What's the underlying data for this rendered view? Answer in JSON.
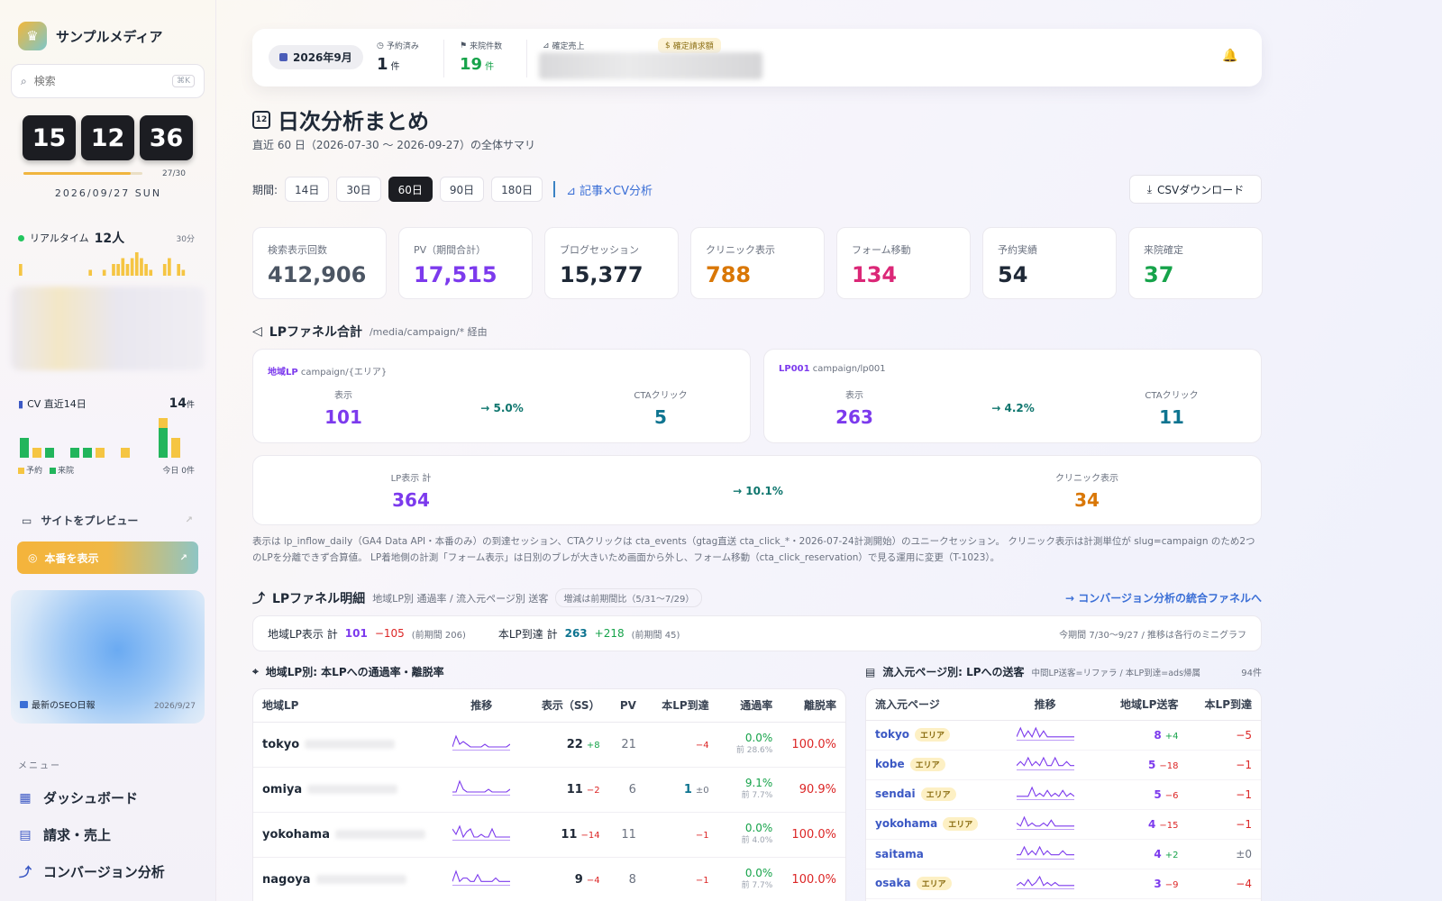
{
  "sidebar": {
    "brand": "サンプルメディア",
    "search_placeholder": "検索",
    "search_kbd": "⌘K",
    "clock": {
      "h": "15",
      "m": "12",
      "s": "36"
    },
    "day_progress_label": "27/30",
    "day_progress_fraction": 0.9,
    "date": "2026/09/27 SUN",
    "realtime_label": "リアルタイム",
    "realtime_count": "12人",
    "realtime_window": "30分",
    "realtime_bars": [
      2,
      0,
      0,
      0,
      0,
      0,
      0,
      0,
      0,
      0,
      0,
      0,
      0,
      0,
      0,
      1,
      0,
      0,
      1,
      0,
      2,
      2,
      3,
      2,
      3,
      4,
      3,
      2,
      1,
      0,
      0,
      2,
      3,
      0,
      2,
      1,
      0,
      0
    ],
    "cv_label": "CV 直近14日",
    "cv_count": "14",
    "cv_unit": "件",
    "cv_bars": [
      {
        "reserve": 0,
        "visit": 4
      },
      {
        "reserve": 2,
        "visit": 0
      },
      {
        "reserve": 0,
        "visit": 2
      },
      {
        "reserve": 0,
        "visit": 0
      },
      {
        "reserve": 0,
        "visit": 2
      },
      {
        "reserve": 0,
        "visit": 2
      },
      {
        "reserve": 2,
        "visit": 0
      },
      {
        "reserve": 0,
        "visit": 0
      },
      {
        "reserve": 2,
        "visit": 0
      },
      {
        "reserve": 0,
        "visit": 0
      },
      {
        "reserve": 0,
        "visit": 0
      },
      {
        "reserve": 2,
        "visit": 6
      },
      {
        "reserve": 4,
        "visit": 0
      },
      {
        "reserve": 0,
        "visit": 0
      }
    ],
    "legend_reserve": "予約",
    "legend_visit": "来院",
    "legend_today": "今日 0件",
    "preview_label": "サイトをプレビュー",
    "honban_label": "本番を表示",
    "seo_label": "最新のSEO日報",
    "seo_date": "2026/9/27",
    "menu_heading": "メニュー",
    "menu": [
      "ダッシュボード",
      "請求・売上",
      "コンバージョン分析"
    ],
    "colors": {
      "reserve": "#f5c542",
      "visit": "#22b55c",
      "accent": "#f0b53e"
    }
  },
  "topbar": {
    "month": "2026年9月",
    "stats": [
      {
        "label": "予約済み",
        "value": "1",
        "unit": "件",
        "icon": "clock-icon"
      },
      {
        "label": "来院件数",
        "value": "19",
        "unit": "件",
        "icon": "flag-icon"
      },
      {
        "label": "確定売上",
        "value": "",
        "unit": "",
        "icon": "chart-icon"
      },
      {
        "label": "確定請求額",
        "value": "",
        "unit": "",
        "icon": "moneybag-icon"
      }
    ]
  },
  "header": {
    "title": "日次分析まとめ",
    "subtitle": "直近 60 日（2026-07-30 〜 2026-09-27）の全体サマリ",
    "period_label": "期間:",
    "periods": [
      "14日",
      "30日",
      "60日",
      "90日",
      "180日"
    ],
    "active_period": "60日",
    "cv_link": "記事×CV分析",
    "csv_button": "CSVダウンロード"
  },
  "kpis": [
    {
      "label": "検索表示回数",
      "value": "412,906",
      "color": "#4b5563"
    },
    {
      "label": "PV（期間合計）",
      "value": "17,515",
      "color": "#7c3aed"
    },
    {
      "label": "ブログセッション",
      "value": "15,377",
      "color": "#1f2937"
    },
    {
      "label": "クリニック表示",
      "value": "788",
      "color": "#d97706"
    },
    {
      "label": "フォーム移動",
      "value": "134",
      "color": "#db2777"
    },
    {
      "label": "予約実績",
      "value": "54",
      "color": "#1f2937"
    },
    {
      "label": "来院確定",
      "value": "37",
      "color": "#16a34a"
    }
  ],
  "funnel": {
    "title": "LPファネル合計",
    "sub": "/media/campaign/* 経由",
    "cards": [
      {
        "tag": "地域LP",
        "path": "campaign/{エリア}",
        "view_label": "表示",
        "view": "101",
        "rate": "→ 5.0%",
        "cta_label": "CTAクリック",
        "cta": "5"
      },
      {
        "tag": "LP001",
        "path": "campaign/lp001",
        "view_label": "表示",
        "view": "263",
        "rate": "→ 4.2%",
        "cta_label": "CTAクリック",
        "cta": "11"
      }
    ],
    "total": {
      "left_label": "LP表示 計",
      "left": "364",
      "rate": "→ 10.1%",
      "right_label": "クリニック表示",
      "right": "34"
    },
    "note": "表示は lp_inflow_daily（GA4 Data API・本番のみ）の到達セッション、CTAクリックは cta_events（gtag直送 cta_click_*・2026-07-24計測開始）のユニークセッション。 クリニック表示は計測単位が slug=campaign のため2つのLPを分離できず合算値。 LP着地側の計測「フォーム表示」は日別のブレが大きいため画面から外し、フォーム移動（cta_click_reservation）で見る運用に変更（T-1023）。"
  },
  "detail": {
    "title": "LPファネル明細",
    "sub": "地域LP別 通過率 / 流入元ページ別 送客",
    "badge": "増減は前期間比（5/31〜7/29）",
    "link": "→ コンバージョン分析の統合ファネルへ",
    "totals": {
      "lp_label": "地域LP表示 計",
      "lp": "101",
      "lp_delta": "−105",
      "lp_prev": "(前期間 206)",
      "main_label": "本LP到達 計",
      "main": "263",
      "main_delta": "+218",
      "main_prev": "(前期間 45)",
      "note": "今期間 7/30〜9/27 / 推移は各行のミニグラフ"
    }
  },
  "lp_table": {
    "title": "地域LP別: 本LPへの通過率・離脱率",
    "headers": [
      "地域LP",
      "推移",
      "表示（SS）",
      "PV",
      "本LP到達",
      "通過率",
      "離脱率"
    ],
    "rows": [
      {
        "name": "tokyo",
        "views": "22",
        "views_delta": "+8",
        "pv": "21",
        "reach": "",
        "reach_delta": "−4",
        "rate": "0.0%",
        "rate_prev": "前 28.6%",
        "exit": "100.0%",
        "spark": [
          1,
          5,
          2,
          3,
          2,
          1,
          1,
          1,
          1,
          2,
          1,
          1,
          1,
          1,
          1,
          1,
          2
        ]
      },
      {
        "name": "omiya",
        "views": "11",
        "views_delta": "−2",
        "pv": "6",
        "reach": "1",
        "reach_delta": "±0",
        "rate": "9.1%",
        "rate_prev": "前 7.7%",
        "exit": "90.9%",
        "spark": [
          1,
          1,
          5,
          2,
          1,
          1,
          1,
          1,
          1,
          1,
          2,
          1,
          1,
          1,
          1,
          1,
          2
        ]
      },
      {
        "name": "yokohama",
        "views": "11",
        "views_delta": "−14",
        "pv": "11",
        "reach": "",
        "reach_delta": "−1",
        "rate": "0.0%",
        "rate_prev": "前 4.0%",
        "exit": "100.0%",
        "spark": [
          4,
          2,
          5,
          1,
          3,
          4,
          1,
          1,
          2,
          1,
          1,
          4,
          1,
          1,
          1,
          1,
          1
        ]
      },
      {
        "name": "nagoya",
        "views": "9",
        "views_delta": "−4",
        "pv": "8",
        "reach": "",
        "reach_delta": "−1",
        "rate": "0.0%",
        "rate_prev": "前 7.7%",
        "exit": "100.0%",
        "spark": [
          1,
          4,
          1,
          2,
          2,
          1,
          1,
          3,
          1,
          1,
          1,
          1,
          2,
          1,
          1,
          1,
          1
        ]
      }
    ]
  },
  "src_table": {
    "title": "流入元ページ別: LPへの送客",
    "sub": "中間LP送客=リファラ / 本LP到達=ads帰属",
    "count": "94件",
    "headers": [
      "流入元ページ",
      "推移",
      "地域LP送客",
      "本LP到達"
    ],
    "area_label": "エリア",
    "rows": [
      {
        "name": "tokyo",
        "area": true,
        "sent": "8",
        "sent_delta": "+4",
        "reach_delta": "−5",
        "spark": [
          1,
          4,
          1,
          3,
          1,
          4,
          1,
          3,
          1,
          1,
          1,
          1,
          1,
          1,
          1,
          1
        ]
      },
      {
        "name": "kobe",
        "area": true,
        "sent": "5",
        "sent_delta": "−18",
        "reach_delta": "−1",
        "spark": [
          1,
          2,
          1,
          3,
          1,
          2,
          1,
          3,
          1,
          1,
          3,
          1,
          1,
          2,
          1,
          1
        ]
      },
      {
        "name": "sendai",
        "area": true,
        "sent": "5",
        "sent_delta": "−6",
        "reach_delta": "−1",
        "spark": [
          1,
          1,
          1,
          1,
          4,
          1,
          2,
          1,
          3,
          1,
          2,
          1,
          3,
          1,
          2,
          1
        ]
      },
      {
        "name": "yokohama",
        "area": true,
        "sent": "4",
        "sent_delta": "−15",
        "reach_delta": "−1",
        "spark": [
          2,
          1,
          4,
          1,
          2,
          1,
          1,
          2,
          1,
          3,
          1,
          1,
          1,
          1,
          1,
          1
        ]
      },
      {
        "name": "saitama",
        "area": false,
        "sent": "4",
        "sent_delta": "+2",
        "reach_delta": "±0",
        "spark": [
          1,
          1,
          3,
          1,
          2,
          1,
          3,
          1,
          2,
          1,
          1,
          1,
          2,
          1,
          1,
          1
        ]
      },
      {
        "name": "osaka",
        "area": true,
        "sent": "3",
        "sent_delta": "−9",
        "reach_delta": "−4",
        "spark": [
          1,
          2,
          1,
          3,
          1,
          2,
          4,
          1,
          2,
          1,
          2,
          1,
          1,
          1,
          1,
          1
        ]
      }
    ]
  }
}
